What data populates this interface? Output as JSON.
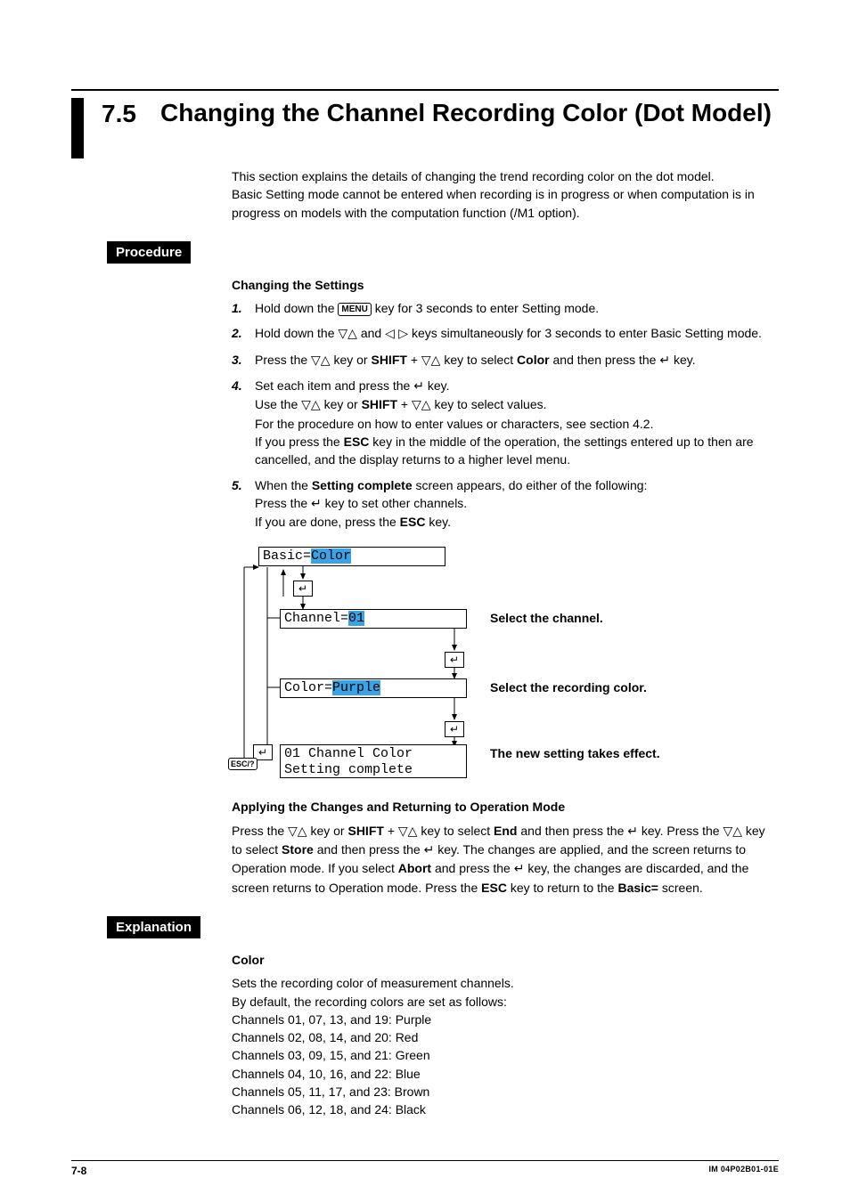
{
  "section": {
    "num": "7.5",
    "title": "Changing the Channel Recording Color (Dot Model)"
  },
  "intro": [
    "This section explains the details of changing the trend recording color on the dot model.",
    "Basic Setting mode cannot be entered when recording is in progress or when computation is in progress on models with the computation function (/M1 option)."
  ],
  "badges": {
    "procedure": "Procedure",
    "explanation": "Explanation"
  },
  "changing": {
    "heading": "Changing the Settings",
    "steps": {
      "s1a": "Hold down the ",
      "s1_menu": "MENU",
      "s1b": " key for 3 seconds to enter Setting mode.",
      "s2a": "Hold down the ",
      "s2b": " and ",
      "s2c": " keys simultaneously for 3 seconds to enter Basic Setting mode.",
      "s3a": "Press the ",
      "s3b": " key or ",
      "s3_shift": "SHIFT",
      "s3c": " + ",
      "s3d": " key to select ",
      "s3_color": "Color",
      "s3e": " and then press the ",
      "s3f": " key.",
      "s4a": "Set each item and press the ",
      "s4b": " key.",
      "s4c": "Use the ",
      "s4d": " key or ",
      "s4_shift": "SHIFT",
      "s4e": " + ",
      "s4f": " key to select values.",
      "s4g": "For the procedure on how to enter values or characters, see section 4.2.",
      "s4h": "If you press the ",
      "s4_esc": "ESC",
      "s4i": " key in the middle of the operation, the settings entered up to then are cancelled, and the display returns to a higher level menu.",
      "s5a": "When the ",
      "s5_sc": "Setting complete",
      "s5b": " screen appears, do either of the following:",
      "s5c": "Press the ",
      "s5d": " key to set other channels.",
      "s5e": "If you are done, press the ",
      "s5_esc": "ESC",
      "s5f": " key."
    }
  },
  "diagram": {
    "lcd_basic_prefix": "Basic=",
    "lcd_basic_value": "Color",
    "lcd_channel_prefix": "Channel=",
    "lcd_channel_value": "01",
    "lcd_color_prefix": "Color=",
    "lcd_color_value": "Purple",
    "lcd_done_line1": "01 Channel Color",
    "lcd_done_line2": "Setting complete",
    "cap_channel": "Select the channel.",
    "cap_color": "Select the recording color.",
    "cap_done": "The new setting takes effect.",
    "esc_label": "ESC/?"
  },
  "applying": {
    "heading": "Applying the Changes and Returning to Operation Mode",
    "t1": "Press the ",
    "t2": " key or ",
    "shift": "SHIFT",
    "t3": " + ",
    "t4": " key to select ",
    "end": "End",
    "t5": " and then press the ",
    "t6": " key. Press the ",
    "t7": " key to select ",
    "store": "Store",
    "t8": " and then press the ",
    "t9": " key. The changes are applied, and the screen returns to Operation mode. If you select ",
    "abort": "Abort",
    "t10": " and press the ",
    "t11": " key, the changes are discarded, and the screen returns to Operation mode. Press the ",
    "esc": "ESC",
    "t12": " key to return to the ",
    "basic": "Basic=",
    "t13": " screen."
  },
  "explanation": {
    "heading": "Color",
    "line1": "Sets the recording color of measurement channels.",
    "line2": "By default, the recording colors are set as follows:",
    "defaults": [
      "Channels 01, 07, 13, and 19: Purple",
      "Channels 02, 08, 14, and 20: Red",
      "Channels 03, 09, 15, and 21: Green",
      "Channels 04, 10, 16, and 22: Blue",
      "Channels 05, 11, 17, and 23: Brown",
      "Channels 06, 12, 18, and 24: Black"
    ]
  },
  "glyphs": {
    "updown": "▽△",
    "leftright": "◁ ▷",
    "enter": "↵"
  },
  "footer": {
    "page": "7-8",
    "docid": "IM 04P02B01-01E"
  }
}
